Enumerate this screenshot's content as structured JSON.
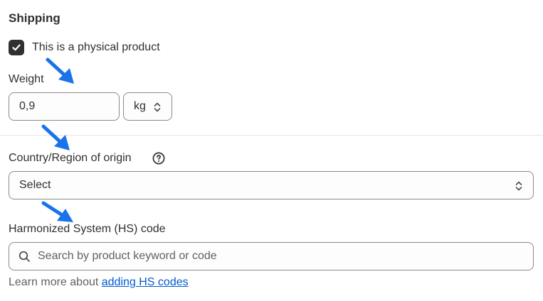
{
  "section_title": "Shipping",
  "physical_product": {
    "label": "This is a physical product",
    "checked": true
  },
  "weight": {
    "label": "Weight",
    "value": "0,9",
    "unit": "kg"
  },
  "country": {
    "label": "Country/Region of origin",
    "selected": "Select"
  },
  "hs_code": {
    "label": "Harmonized System (HS) code",
    "placeholder": "Search by product keyword or code"
  },
  "learn_more": {
    "prefix": "Learn more about ",
    "link_text": "adding HS codes"
  },
  "colors": {
    "text": "#303030",
    "border": "#8a8a8a",
    "link": "#005bd3",
    "annotation_arrow": "#1a73e8"
  },
  "icons": {
    "checkbox": "checkmark-icon",
    "unit_select": "chevron-up-down-icon",
    "help": "question-circle-icon",
    "search": "search-icon",
    "annotation": "arrow-annotation-icon"
  }
}
